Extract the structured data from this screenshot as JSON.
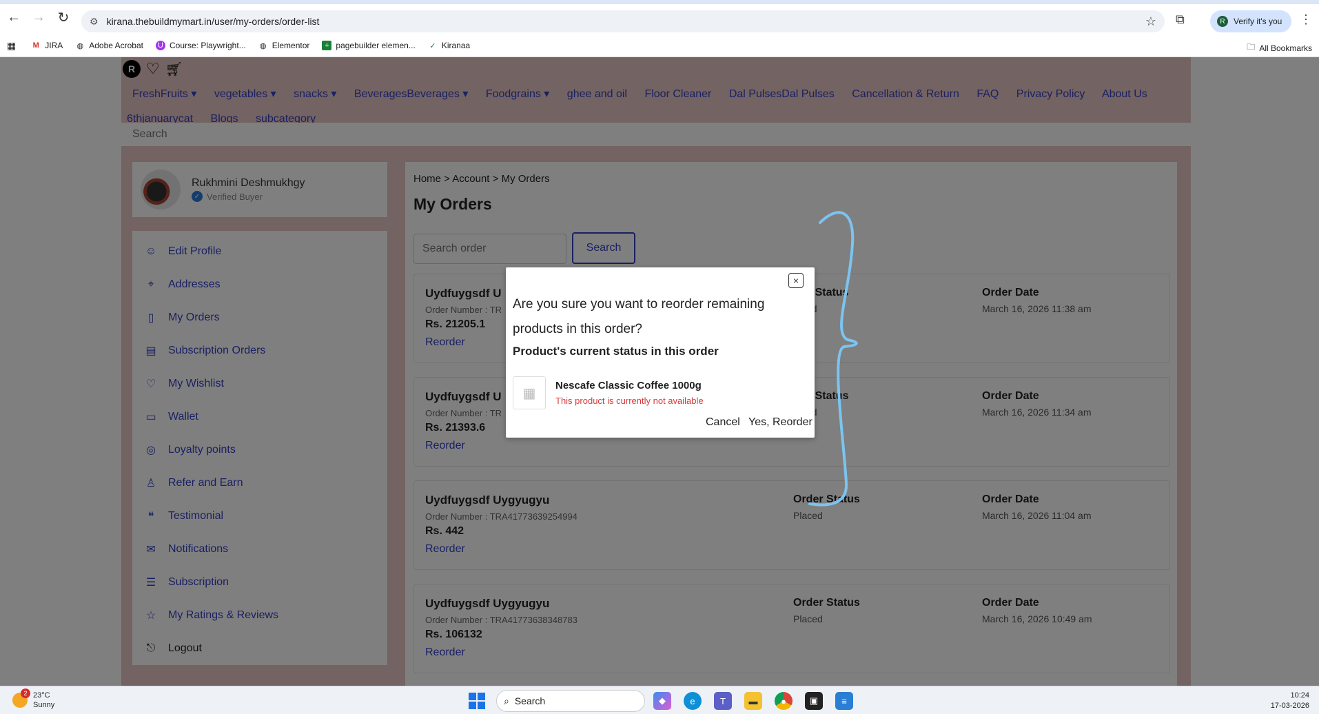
{
  "browser": {
    "url": "kirana.thebuildmymart.in/user/my-orders/order-list",
    "verify_label": "Verify it's you",
    "verify_avatar": "R",
    "bookmarks": [
      {
        "label": "JIRA",
        "icon": "gmail-icon"
      },
      {
        "label": "Adobe Acrobat",
        "icon": "globe-icon"
      },
      {
        "label": "Course: Playwright...",
        "icon": "udemy-icon"
      },
      {
        "label": "Elementor",
        "icon": "globe-icon"
      },
      {
        "label": "pagebuilder elemen...",
        "icon": "sheets-icon"
      },
      {
        "label": "Kiranaa",
        "icon": "check-icon"
      }
    ],
    "all_bookmarks": "All Bookmarks"
  },
  "site": {
    "avatar_letter": "R",
    "menu_row1": [
      "FreshFruits ▾",
      "vegetables ▾",
      "snacks ▾",
      "BeveragesBeverages ▾",
      "Foodgrains ▾",
      "ghee and oil",
      "Floor Cleaner",
      "Dal PulsesDal Pulses",
      "Cancellation & Return",
      "FAQ",
      "Privacy Policy",
      "About Us"
    ],
    "menu_row2": [
      "6thjanuarycat",
      "Blogs",
      "subcategory"
    ],
    "search_placeholder": "Search"
  },
  "profile": {
    "name": "Rukhmini Deshmukhgy",
    "badge": "Verified Buyer"
  },
  "sidebar": {
    "items": [
      {
        "label": "Edit Profile",
        "icon": "user-icon"
      },
      {
        "label": "Addresses",
        "icon": "location-icon"
      },
      {
        "label": "My Orders",
        "icon": "orders-icon"
      },
      {
        "label": "Subscription Orders",
        "icon": "subscription-orders-icon"
      },
      {
        "label": "My Wishlist",
        "icon": "heart-icon"
      },
      {
        "label": "Wallet",
        "icon": "wallet-icon"
      },
      {
        "label": "Loyalty points",
        "icon": "coins-icon"
      },
      {
        "label": "Refer and Earn",
        "icon": "refer-icon"
      },
      {
        "label": "Testimonial",
        "icon": "quote-icon"
      },
      {
        "label": "Notifications",
        "icon": "mail-icon"
      },
      {
        "label": "Subscription",
        "icon": "subscription-icon"
      },
      {
        "label": "My Ratings & Reviews",
        "icon": "star-icon"
      }
    ],
    "logout": "Logout"
  },
  "main": {
    "breadcrumb": "Home > Account > My Orders",
    "title": "My Orders",
    "search_placeholder": "Search order",
    "search_button": "Search",
    "orders": [
      {
        "name": "Uydfuygsdf U",
        "number": "Order Number : TR",
        "price": "Rs. 21205.1",
        "reorder": "Reorder",
        "status_label": "er Status",
        "status": "ced",
        "date_label": "Order Date",
        "date": "March 16, 2026 11:38 am"
      },
      {
        "name": "Uydfuygsdf U",
        "number": "Order Number : TR",
        "price": "Rs. 21393.6",
        "reorder": "Reorder",
        "status_label": "er Status",
        "status": "ced",
        "date_label": "Order Date",
        "date": "March 16, 2026 11:34 am"
      },
      {
        "name": "Uydfuygsdf Uygyugyu",
        "number": "Order Number : TRA41773639254994",
        "price": "Rs. 442",
        "reorder": "Reorder",
        "status_label": "Order Status",
        "status": "Placed",
        "date_label": "Order Date",
        "date": "March 16, 2026 11:04 am"
      },
      {
        "name": "Uydfuygsdf Uygyugyu",
        "number": "Order Number : TRA41773638348783",
        "price": "Rs. 106132",
        "reorder": "Reorder",
        "status_label": "Order Status",
        "status": "Placed",
        "date_label": "Order Date",
        "date": "March 16, 2026 10:49 am"
      }
    ]
  },
  "modal": {
    "close": "×",
    "question": "Are you sure you want to reorder remaining products in this order?",
    "subheading": "Product's current status in this order",
    "product_name": "Nescafe Classic Coffee 1000g",
    "product_status": "This product is currently not available",
    "cancel": "Cancel",
    "confirm": "Yes, Reorder"
  },
  "taskbar": {
    "temp": "23°C",
    "weather": "Sunny",
    "weather_badge": "2",
    "search": "Search",
    "time": "10:24",
    "date": "17-03-2026"
  },
  "colors": {
    "link": "#3540c6",
    "error": "#d63b3b",
    "annotation": "#7cc4f0"
  }
}
